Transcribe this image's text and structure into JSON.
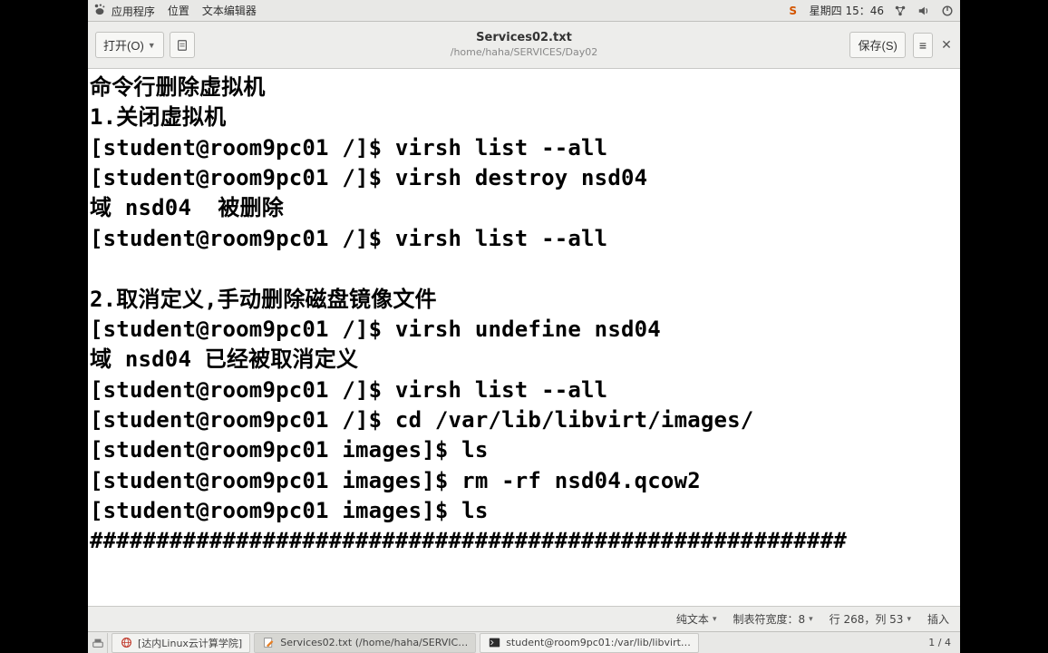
{
  "panel": {
    "applications": "应用程序",
    "places": "位置",
    "editor_menu": "文本编辑器",
    "clock": "星期四 15：46"
  },
  "header": {
    "open_label": "打开(O)",
    "save_label": "保存(S)",
    "title_file": "Services02.txt",
    "title_path": "/home/haha/SERVICES/Day02"
  },
  "content": {
    "lines": [
      "命令行删除虚拟机",
      "1.关闭虚拟机",
      "[student@room9pc01 /]$ virsh list --all",
      "[student@room9pc01 /]$ virsh destroy nsd04",
      "域 nsd04  被删除",
      "[student@room9pc01 /]$ virsh list --all",
      "",
      "2.取消定义,手动删除磁盘镜像文件",
      "[student@room9pc01 /]$ virsh undefine nsd04",
      "域 nsd04 已经被取消定义",
      "[student@room9pc01 /]$ virsh list --all",
      "[student@room9pc01 /]$ cd /var/lib/libvirt/images/",
      "[student@room9pc01 images]$ ls",
      "[student@room9pc01 images]$ rm -rf nsd04.qcow2",
      "[student@room9pc01 images]$ ls",
      "#########################################################"
    ]
  },
  "status": {
    "plain_text": "纯文本",
    "tab_width": "制表符宽度：8",
    "line_col": "行 268，列 53",
    "insert_mode": "插入"
  },
  "taskbar": {
    "items": [
      {
        "icon": "browser",
        "label": "[达内Linux云计算学院]"
      },
      {
        "icon": "gedit",
        "label": "Services02.txt (/home/haha/SERVIC…"
      },
      {
        "icon": "terminal",
        "label": "student@room9pc01:/var/lib/libvirt…"
      }
    ],
    "page": "1 / 4"
  }
}
